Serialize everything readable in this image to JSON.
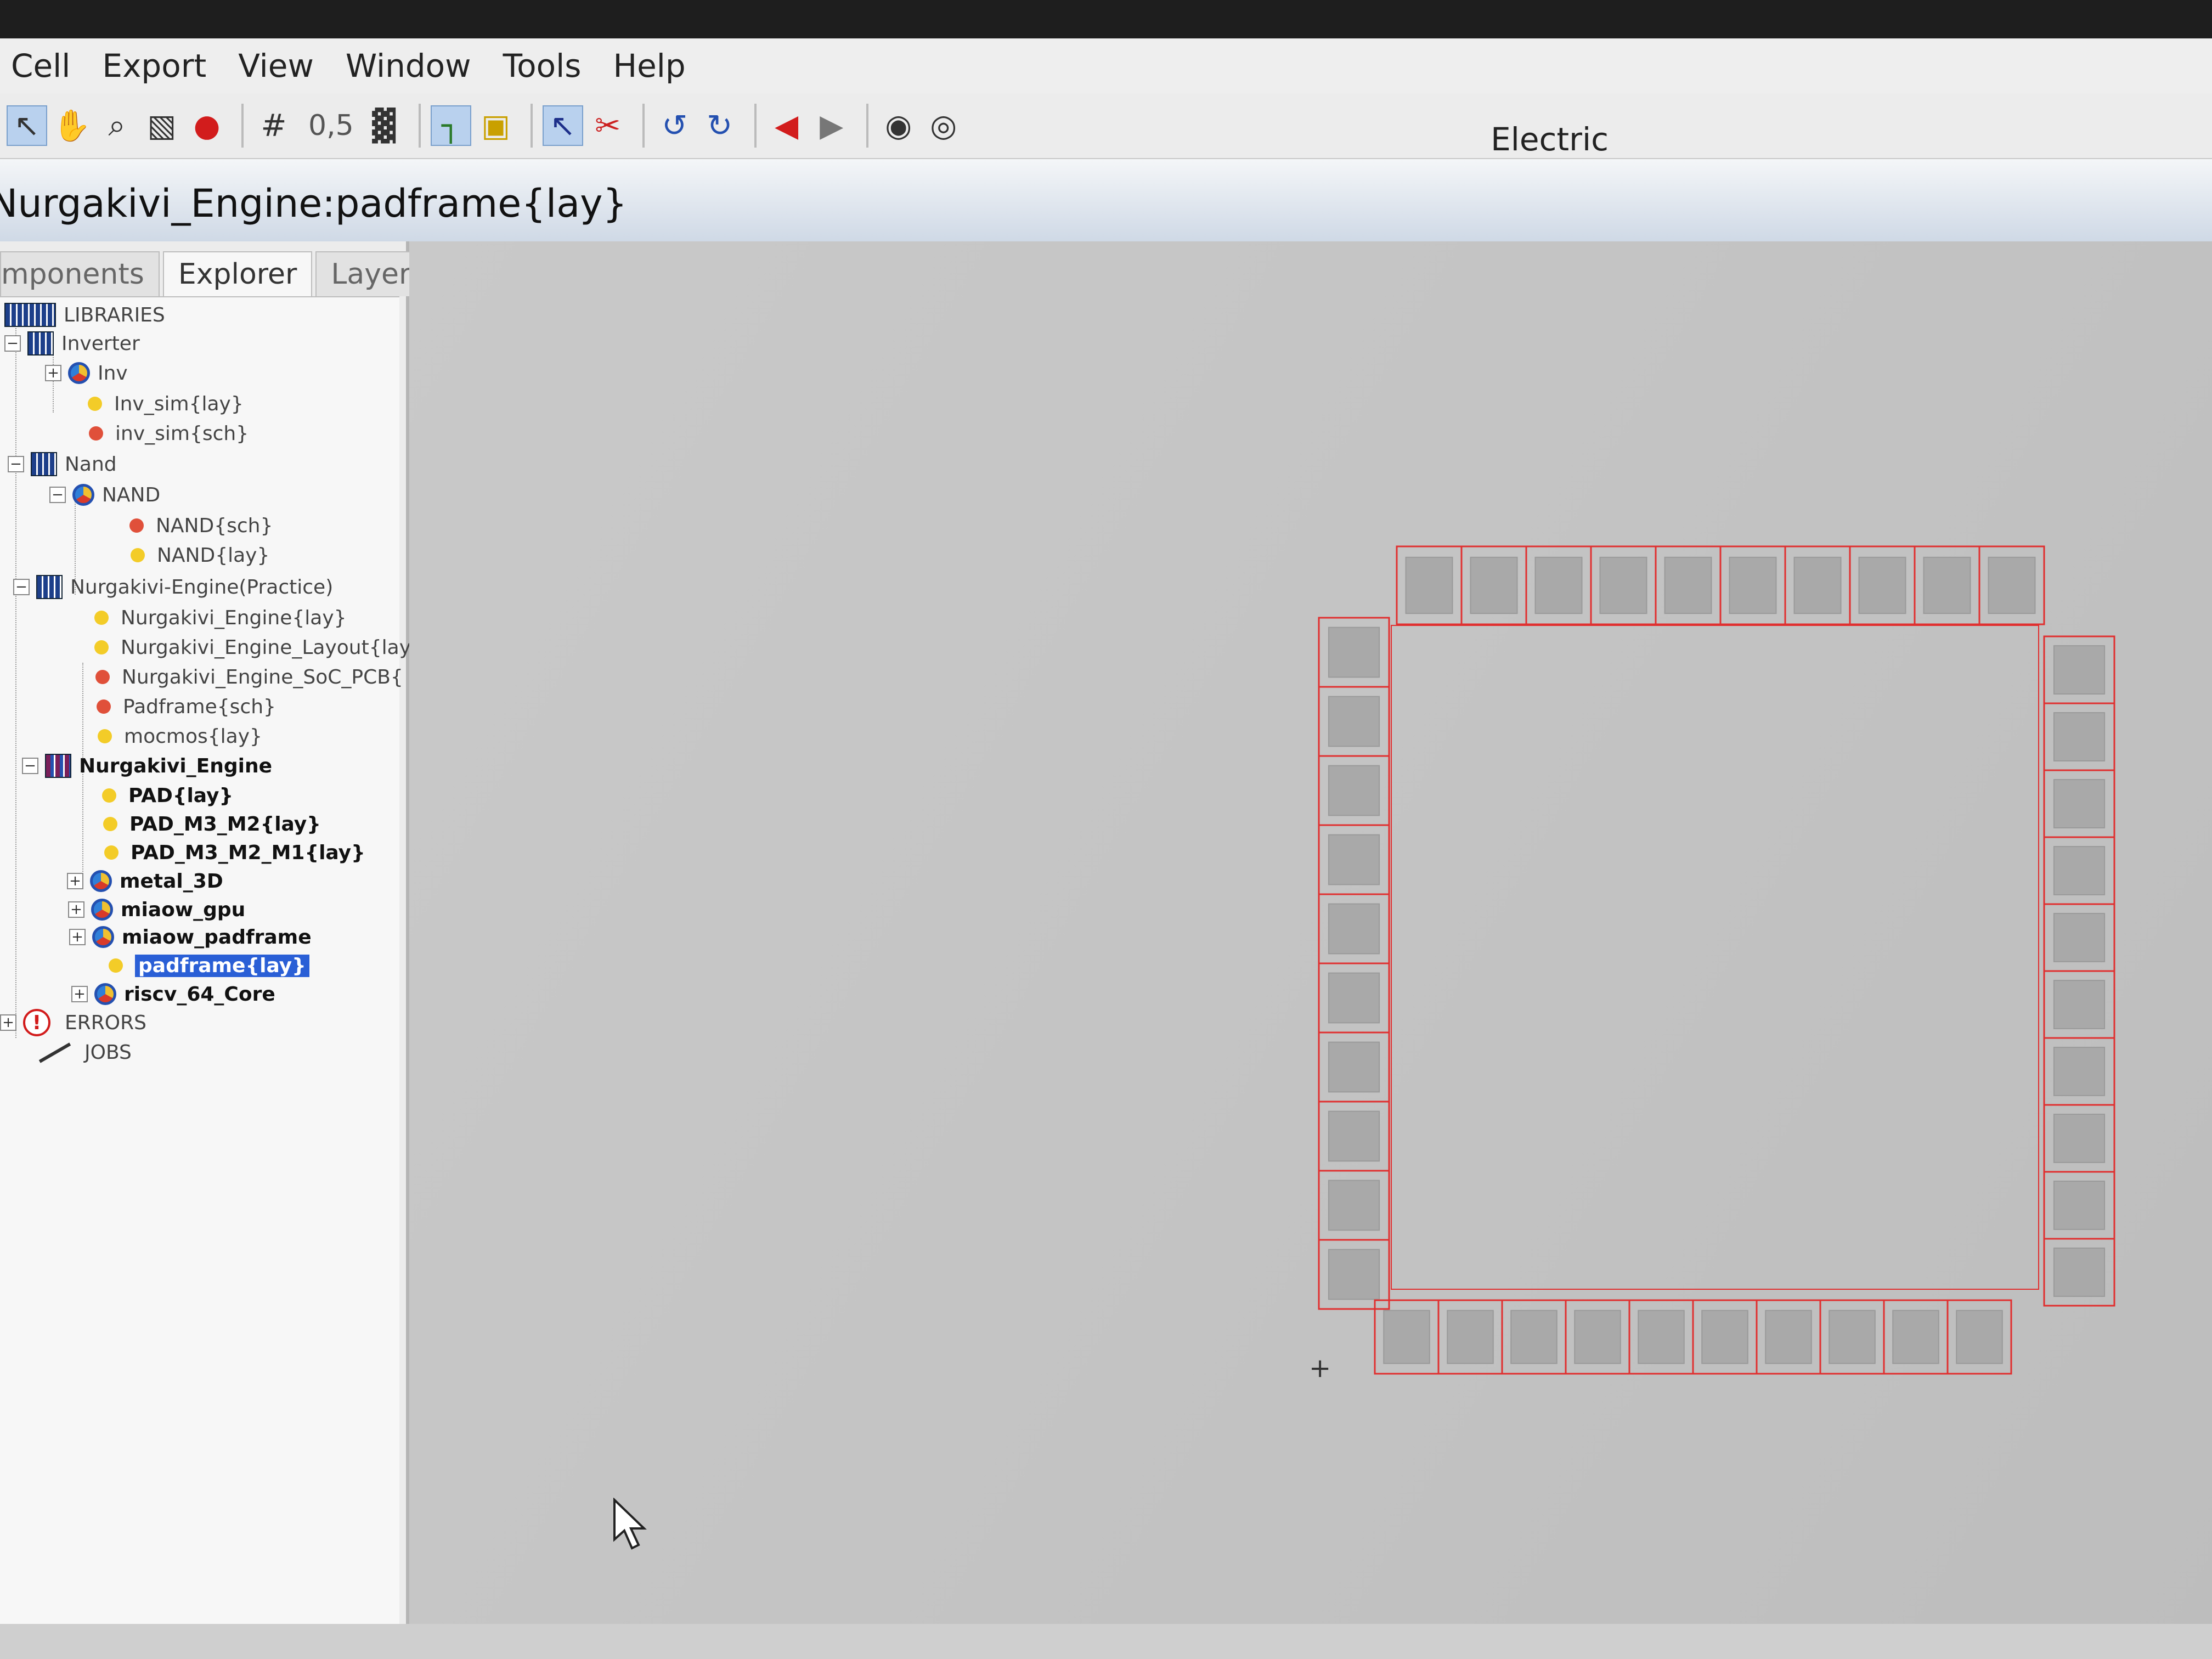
{
  "menubar": {
    "items": [
      "Cell",
      "Export",
      "View",
      "Window",
      "Tools",
      "Help"
    ]
  },
  "app_title": "Electric",
  "toolbar": {
    "zoom_value": "0,5",
    "icons": [
      "select-arrow-icon",
      "pan-hand-icon",
      "zoom-magnifier-icon",
      "outline-edit-icon",
      "stop-icon",
      "grid-icon",
      "measure-icon",
      "place-arc-icon",
      "place-node-icon",
      "select-objects-icon",
      "cut-icon",
      "undo-icon",
      "redo-icon",
      "back-arrow-icon",
      "forward-arrow-icon",
      "show-layer-icon",
      "hide-layer-icon"
    ]
  },
  "window": {
    "title": "Nurgakivi_Engine:padframe{lay}"
  },
  "panel": {
    "tabs": [
      "mponents",
      "Explorer",
      "Layers"
    ],
    "tree": {
      "libraries": "LIBRARIES",
      "inverter": "Inverter",
      "inv": "Inv",
      "inv_sim_lay": "Inv_sim{lay}",
      "inv_sim_sch": "inv_sim{sch}",
      "nand_lib": "Nand",
      "nand_cell": "NAND",
      "nand_sch": "NAND{sch}",
      "nand_lay": "NAND{lay}",
      "practice": "Nurgakivi-Engine(Practice)",
      "p_engine_lay": "Nurgakivi_Engine{lay}",
      "p_engine_layout": "Nurgakivi_Engine_Layout{lay",
      "p_engine_soc": "Nurgakivi_Engine_SoC_PCB{",
      "p_padframe_sch": "Padframe{sch}",
      "p_mocmos": "mocmos{lay}",
      "engine": "Nurgakivi_Engine",
      "pad_lay": "PAD{lay}",
      "pad_m3_m2": "PAD_M3_M2{lay}",
      "pad_m3_m2_m1": "PAD_M3_M2_M1{lay}",
      "metal_3d": "metal_3D",
      "miaow_gpu": "miaow_gpu",
      "miaow_padframe": "miaow_padframe",
      "padframe_lay": "padframe{lay}",
      "riscv": "riscv_64_Core",
      "errors": "ERRORS",
      "jobs": "JOBS"
    }
  },
  "colors": {
    "selection": "#2a5fd6",
    "layout_dot": "#f3cc28",
    "schematic_dot": "#e0503a",
    "pad_outline": "#e03030",
    "pad_fill": "#a9a9a9"
  }
}
